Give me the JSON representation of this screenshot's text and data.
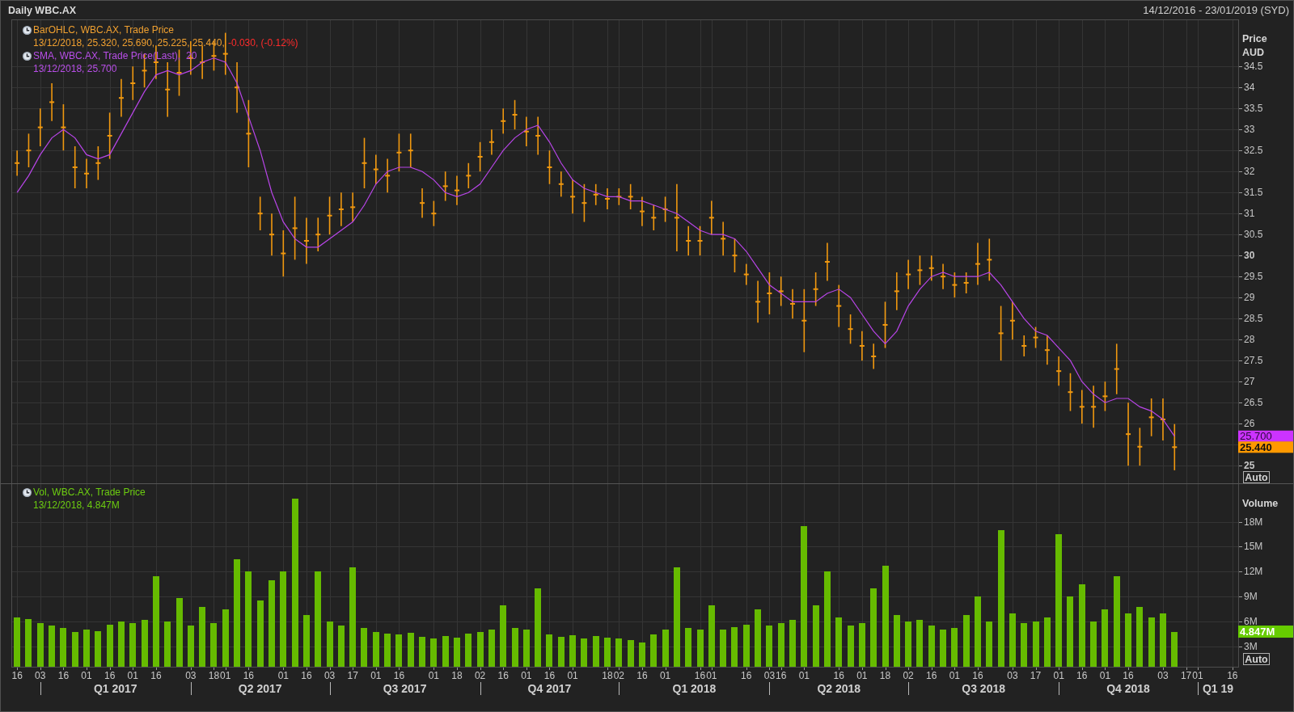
{
  "window": {
    "title": "Daily WBC.AX",
    "date_range": "14/12/2016 - 23/01/2019 (SYD)"
  },
  "price_panel": {
    "legend": [
      {
        "color": "#f0a030",
        "title": "BarOHLC, WBC.AX, Trade Price",
        "values": "13/12/2018, 25.320, 25.690, 25.225, 25.440,",
        "change": "-0.030, (-0.12%)"
      },
      {
        "color": "#b84ee8",
        "title": "SMA, WBC.AX, Trade Price(Last),",
        "period": "20",
        "values": "13/12/2018, 25.700"
      }
    ],
    "axis": {
      "title": "Price",
      "unit": "AUD"
    },
    "last_value_tags": [
      {
        "kind": "sma",
        "text": "25.700",
        "color": "#cc33ff"
      },
      {
        "kind": "close",
        "text": "25.440",
        "color": "#ff9900"
      }
    ],
    "auto_button": {
      "label": "Auto"
    },
    "chart_data": {
      "type": "scatter",
      "grid": true,
      "categories": [
        null,
        null,
        null,
        null,
        null,
        null,
        null,
        null,
        null,
        null,
        null,
        null,
        null,
        null,
        null,
        null,
        null,
        null,
        null,
        null,
        null,
        null,
        null,
        null,
        null,
        null,
        null,
        null,
        null,
        null,
        null,
        null,
        null,
        null,
        null,
        null,
        null,
        null,
        null,
        null,
        null,
        null,
        null,
        null,
        null,
        null,
        null,
        null,
        null,
        null,
        null,
        null,
        null,
        null,
        null,
        null,
        null,
        null,
        null,
        null,
        null,
        null,
        null,
        null,
        null,
        null,
        null,
        null,
        null,
        null,
        null,
        null,
        null,
        null,
        null,
        null,
        null,
        null,
        null,
        null,
        null,
        null,
        null,
        null,
        null,
        null,
        null,
        null,
        null,
        null,
        null,
        null,
        null,
        null,
        null,
        null,
        null,
        null,
        null,
        null,
        null,
        null,
        null,
        null,
        null,
        null
      ],
      "ylim": [
        24.58,
        35.6
      ],
      "yticks": [
        25,
        26,
        26.5,
        27,
        27.5,
        28,
        28.5,
        29,
        29.5,
        30,
        30.5,
        31,
        31.5,
        32,
        32.5,
        33,
        33.5,
        34,
        34.5
      ],
      "series": [
        {
          "color": "#f0980f",
          "values": [
            32.2,
            32.5,
            33.05,
            33.65,
            33.05,
            32.1,
            31.95,
            32.2,
            32.85,
            33.75,
            34.1,
            34.4,
            34.6,
            33.95,
            34.35,
            34.7,
            34.6,
            34.75,
            34.8,
            34.0,
            32.9,
            31.0,
            30.5,
            30.05,
            30.65,
            30.35,
            30.5,
            30.95,
            31.1,
            31.15,
            32.2,
            32.05,
            31.9,
            32.45,
            32.5,
            31.25,
            31.0,
            31.65,
            31.55,
            31.9,
            32.35,
            32.7,
            33.2,
            33.35,
            32.95,
            32.85,
            32.1,
            31.7,
            31.4,
            31.25,
            31.45,
            31.35,
            31.4,
            31.4,
            31.05,
            30.9,
            31.1,
            30.9,
            30.35,
            30.35,
            30.9,
            30.4,
            30.0,
            29.55,
            28.9,
            29.1,
            29.15,
            28.85,
            28.45,
            29.2,
            29.85,
            28.8,
            28.25,
            27.85,
            27.6,
            28.35,
            29.15,
            29.55,
            29.65,
            29.7,
            29.5,
            29.3,
            29.35,
            29.8,
            29.9,
            28.15,
            28.45,
            27.85,
            28.05,
            27.75,
            27.25,
            26.75,
            26.4,
            26.4,
            26.65,
            27.3,
            25.75,
            25.45,
            26.15,
            26.1,
            25.44,
            null,
            null,
            null,
            null,
            null
          ],
          "errors": [
            0.3,
            0.4,
            0.45,
            0.45,
            0.55,
            0.5,
            0.35,
            0.4,
            0.55,
            0.45,
            0.4,
            0.4,
            0.4,
            0.65,
            0.55,
            0.4,
            0.4,
            0.35,
            0.5,
            0.6,
            0.8,
            0.4,
            0.5,
            0.55,
            0.75,
            0.55,
            0.4,
            0.45,
            0.4,
            0.35,
            0.6,
            0.35,
            0.4,
            0.45,
            0.4,
            0.35,
            0.3,
            0.35,
            0.35,
            0.3,
            0.35,
            0.3,
            0.3,
            0.35,
            0.35,
            0.45,
            0.4,
            0.3,
            0.4,
            0.45,
            0.25,
            0.25,
            0.2,
            0.3,
            0.35,
            0.3,
            0.3,
            0.8,
            0.35,
            0.35,
            0.4,
            0.4,
            0.4,
            0.25,
            0.5,
            0.5,
            0.35,
            0.35,
            0.75,
            0.4,
            0.45,
            0.5,
            0.35,
            0.35,
            0.3,
            0.55,
            0.45,
            0.35,
            0.35,
            0.3,
            0.3,
            0.3,
            0.25,
            0.5,
            0.5,
            0.65,
            0.45,
            0.25,
            0.25,
            0.35,
            0.35,
            0.45,
            0.4,
            0.5,
            0.35,
            0.6,
            0.75,
            0.45,
            0.45,
            0.5,
            0.55,
            null,
            null,
            null,
            null,
            null
          ]
        },
        {
          "type": "line",
          "color": "#b845e8",
          "values": [
            31.5,
            31.9,
            32.4,
            32.8,
            33.0,
            32.8,
            32.4,
            32.3,
            32.4,
            32.9,
            33.4,
            33.9,
            34.3,
            34.4,
            34.3,
            34.4,
            34.6,
            34.7,
            34.6,
            34.1,
            33.3,
            32.5,
            31.5,
            30.8,
            30.4,
            30.2,
            30.2,
            30.4,
            30.6,
            30.8,
            31.2,
            31.7,
            32.0,
            32.1,
            32.1,
            32.0,
            31.8,
            31.5,
            31.4,
            31.5,
            31.7,
            32.1,
            32.5,
            32.8,
            33.0,
            33.1,
            32.7,
            32.2,
            31.8,
            31.6,
            31.5,
            31.4,
            31.4,
            31.3,
            31.3,
            31.2,
            31.1,
            31.0,
            30.8,
            30.6,
            30.5,
            30.5,
            30.4,
            30.1,
            29.7,
            29.3,
            29.1,
            28.9,
            28.9,
            28.9,
            29.1,
            29.2,
            29.0,
            28.6,
            28.2,
            27.9,
            28.2,
            28.8,
            29.2,
            29.5,
            29.6,
            29.5,
            29.5,
            29.5,
            29.6,
            29.3,
            28.9,
            28.5,
            28.2,
            28.1,
            27.8,
            27.5,
            27.0,
            26.7,
            26.5,
            26.6,
            26.6,
            26.4,
            26.3,
            26.1,
            25.7,
            null,
            null,
            null,
            null,
            null
          ]
        }
      ]
    }
  },
  "volume_panel": {
    "legend": [
      {
        "color": "#6ccc10",
        "title": "Vol, WBC.AX, Trade Price",
        "values": "13/12/2018, 4.847M"
      }
    ],
    "axis": {
      "title": "Volume"
    },
    "last_value_tags": [
      {
        "kind": "volume",
        "text": "4.847M",
        "color": "#66cc00"
      }
    ],
    "auto_button": {
      "label": "Auto"
    },
    "chart_data": {
      "type": "bar",
      "grid": true,
      "categories": [
        "16",
        null,
        "03",
        null,
        "16",
        null,
        "01",
        null,
        "16",
        null,
        "01",
        null,
        "16",
        null,
        null,
        "03",
        null,
        "18",
        "01",
        null,
        "16",
        null,
        null,
        "01",
        null,
        "16",
        null,
        "03",
        null,
        "17",
        null,
        "01",
        null,
        "16",
        null,
        null,
        "01",
        null,
        "18",
        null,
        "02",
        null,
        "16",
        null,
        "01",
        null,
        "16",
        null,
        "01",
        null,
        null,
        "18",
        "02",
        null,
        "16",
        null,
        "01",
        null,
        null,
        "16",
        "01",
        null,
        null,
        "16",
        null,
        "03",
        "16",
        null,
        "01",
        null,
        null,
        "16",
        null,
        "01",
        null,
        "18",
        null,
        "02",
        null,
        "16",
        null,
        "01",
        null,
        "16",
        null,
        null,
        "03",
        null,
        "17",
        null,
        "01",
        null,
        "16",
        null,
        "01",
        null,
        "16",
        null,
        null,
        "03",
        null,
        "17",
        "01",
        null,
        null,
        "16"
      ],
      "ylim": [
        0.58,
        22.62
      ],
      "yticks": [
        {
          "value": 3,
          "label": "3M"
        },
        {
          "value": 6,
          "label": "6M"
        },
        {
          "value": 9,
          "label": "9M"
        },
        {
          "value": 12,
          "label": "12M"
        },
        {
          "value": 15,
          "label": "15M"
        },
        {
          "value": 18,
          "label": "18M"
        }
      ],
      "annotations": [
        "Q1 2017",
        "Q2 2017",
        "Q3 2017",
        "Q4 2017",
        "Q1 2018",
        "Q2 2018",
        "Q3 2018",
        "Q4 2018",
        "Q1 19"
      ],
      "series": [
        {
          "color": "#66bb00",
          "values": [
            6.5,
            6.3,
            5.8,
            5.5,
            5.2,
            4.8,
            5.0,
            4.9,
            5.6,
            6.0,
            5.8,
            6.2,
            11.5,
            6.0,
            8.8,
            5.5,
            7.8,
            5.8,
            7.5,
            13.5,
            12.0,
            8.5,
            11.0,
            12.0,
            20.8,
            6.8,
            12.0,
            6.0,
            5.5,
            12.5,
            5.2,
            4.8,
            4.6,
            4.5,
            4.7,
            4.2,
            4.0,
            4.3,
            4.1,
            4.6,
            4.8,
            5.0,
            8.0,
            5.2,
            5.0,
            10.0,
            4.5,
            4.2,
            4.4,
            4.0,
            4.3,
            4.1,
            4.0,
            3.8,
            3.5,
            4.5,
            5.0,
            12.5,
            5.2,
            5.0,
            8.0,
            5.0,
            5.3,
            5.6,
            7.5,
            5.5,
            5.8,
            6.2,
            17.5,
            8.0,
            12.0,
            6.5,
            5.5,
            5.8,
            10.0,
            12.7,
            6.8,
            6.0,
            6.2,
            5.5,
            5.0,
            5.2,
            6.8,
            9.0,
            6.0,
            17.0,
            7.0,
            5.8,
            6.0,
            6.5,
            16.5,
            9.0,
            10.5,
            6.0,
            7.5,
            11.5,
            7.0,
            7.8,
            6.5,
            7.0,
            4.8,
            null,
            null,
            null,
            null,
            null
          ]
        }
      ]
    }
  }
}
